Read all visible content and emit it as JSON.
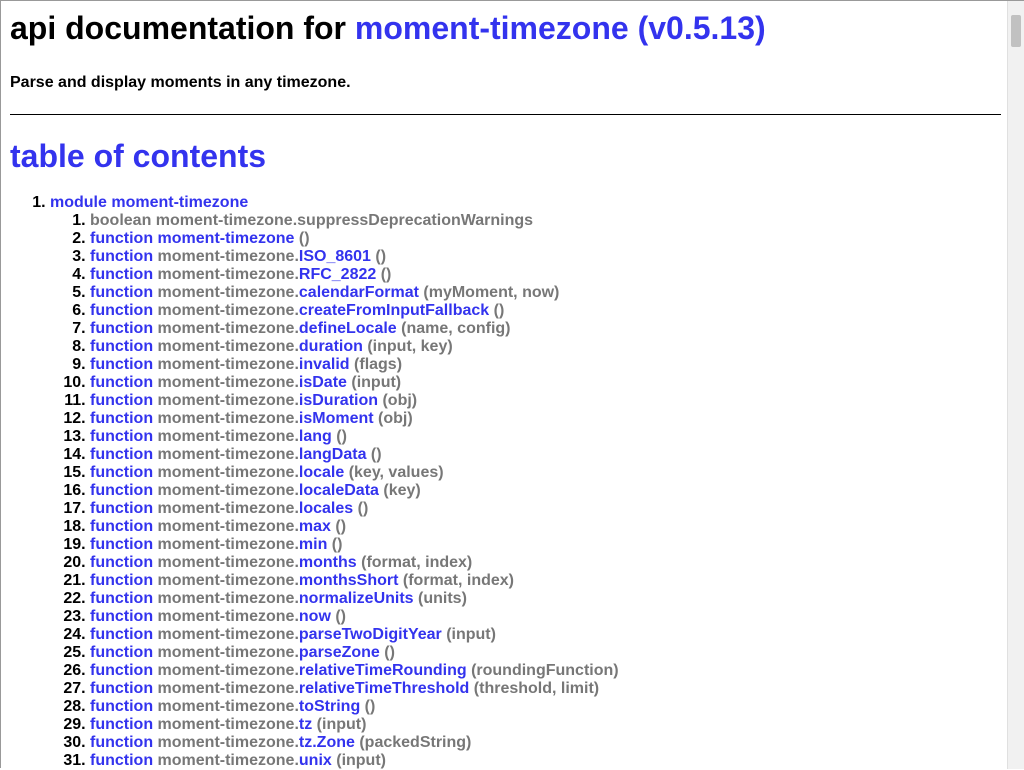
{
  "header": {
    "title_prefix": "api documentation for ",
    "package_link": "moment-timezone (v0.5.13)",
    "description": "Parse and display moments in any timezone."
  },
  "toc": {
    "heading": "table of contents",
    "module": {
      "keyword": "module",
      "name": "moment-timezone"
    },
    "items": [
      {
        "kind": "boolean",
        "prefix": "moment-timezone.suppressDeprecationWarnings",
        "name": "",
        "args": ""
      },
      {
        "kind": "function",
        "prefix": "",
        "name": "moment-timezone",
        "args": "()"
      },
      {
        "kind": "function",
        "prefix": "moment-timezone.",
        "name": "ISO_8601",
        "args": "()"
      },
      {
        "kind": "function",
        "prefix": "moment-timezone.",
        "name": "RFC_2822",
        "args": "()"
      },
      {
        "kind": "function",
        "prefix": "moment-timezone.",
        "name": "calendarFormat",
        "args": "(myMoment, now)"
      },
      {
        "kind": "function",
        "prefix": "moment-timezone.",
        "name": "createFromInputFallback",
        "args": "()"
      },
      {
        "kind": "function",
        "prefix": "moment-timezone.",
        "name": "defineLocale",
        "args": "(name, config)"
      },
      {
        "kind": "function",
        "prefix": "moment-timezone.",
        "name": "duration",
        "args": "(input, key)"
      },
      {
        "kind": "function",
        "prefix": "moment-timezone.",
        "name": "invalid",
        "args": "(flags)"
      },
      {
        "kind": "function",
        "prefix": "moment-timezone.",
        "name": "isDate",
        "args": "(input)"
      },
      {
        "kind": "function",
        "prefix": "moment-timezone.",
        "name": "isDuration",
        "args": "(obj)"
      },
      {
        "kind": "function",
        "prefix": "moment-timezone.",
        "name": "isMoment",
        "args": "(obj)"
      },
      {
        "kind": "function",
        "prefix": "moment-timezone.",
        "name": "lang",
        "args": "()"
      },
      {
        "kind": "function",
        "prefix": "moment-timezone.",
        "name": "langData",
        "args": "()"
      },
      {
        "kind": "function",
        "prefix": "moment-timezone.",
        "name": "locale",
        "args": "(key, values)"
      },
      {
        "kind": "function",
        "prefix": "moment-timezone.",
        "name": "localeData",
        "args": "(key)"
      },
      {
        "kind": "function",
        "prefix": "moment-timezone.",
        "name": "locales",
        "args": "()"
      },
      {
        "kind": "function",
        "prefix": "moment-timezone.",
        "name": "max",
        "args": "()"
      },
      {
        "kind": "function",
        "prefix": "moment-timezone.",
        "name": "min",
        "args": "()"
      },
      {
        "kind": "function",
        "prefix": "moment-timezone.",
        "name": "months",
        "args": "(format, index)"
      },
      {
        "kind": "function",
        "prefix": "moment-timezone.",
        "name": "monthsShort",
        "args": "(format, index)"
      },
      {
        "kind": "function",
        "prefix": "moment-timezone.",
        "name": "normalizeUnits",
        "args": "(units)"
      },
      {
        "kind": "function",
        "prefix": "moment-timezone.",
        "name": "now",
        "args": "()"
      },
      {
        "kind": "function",
        "prefix": "moment-timezone.",
        "name": "parseTwoDigitYear",
        "args": "(input)"
      },
      {
        "kind": "function",
        "prefix": "moment-timezone.",
        "name": "parseZone",
        "args": "()"
      },
      {
        "kind": "function",
        "prefix": "moment-timezone.",
        "name": "relativeTimeRounding",
        "args": "(roundingFunction)"
      },
      {
        "kind": "function",
        "prefix": "moment-timezone.",
        "name": "relativeTimeThreshold",
        "args": "(threshold, limit)"
      },
      {
        "kind": "function",
        "prefix": "moment-timezone.",
        "name": "toString",
        "args": "()"
      },
      {
        "kind": "function",
        "prefix": "moment-timezone.",
        "name": "tz",
        "args": "(input)"
      },
      {
        "kind": "function",
        "prefix": "moment-timezone.",
        "name": "tz.Zone",
        "args": "(packedString)"
      },
      {
        "kind": "function",
        "prefix": "moment-timezone.",
        "name": "unix",
        "args": "(input)"
      }
    ]
  },
  "colors": {
    "link": "#3333ee",
    "muted": "#777777"
  }
}
